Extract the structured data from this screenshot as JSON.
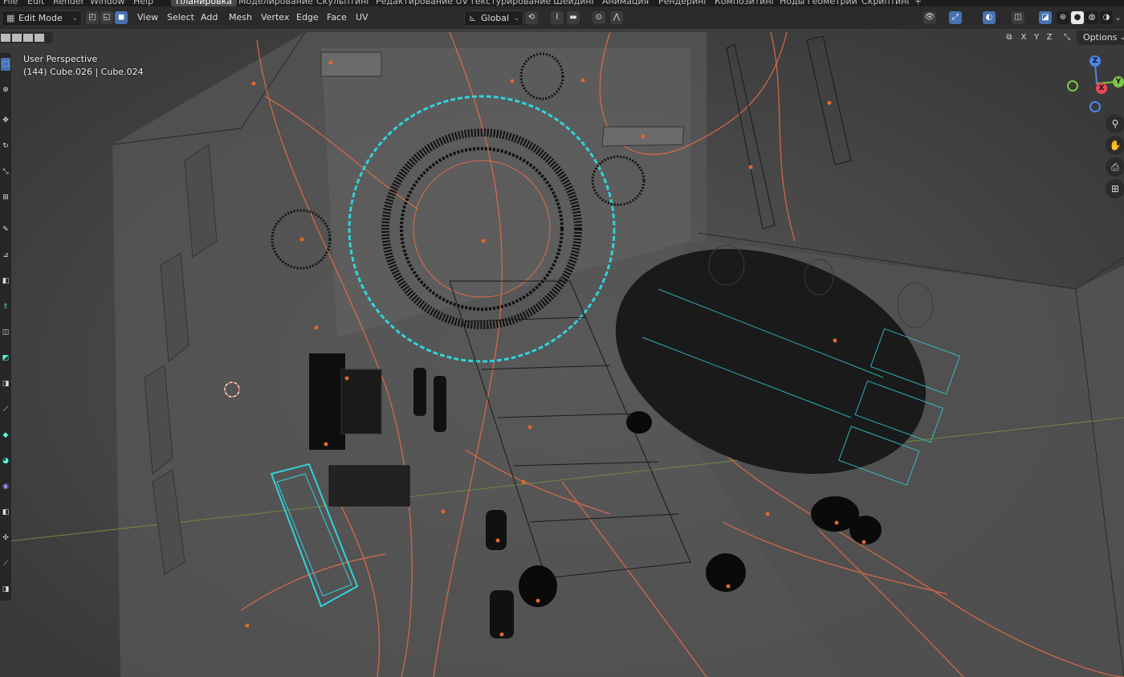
{
  "top_menu": {
    "file": "File",
    "edit": "Edit",
    "render": "Render",
    "window": "Window",
    "help": "Help",
    "workspaces": [
      "Планировка",
      "Моделирование",
      "Скульптинг",
      "Редактирование UV",
      "Текстурирование",
      "Шейдинг",
      "Анимация",
      "Рендеринг",
      "Композитинг",
      "Ноды геометрии",
      "Скриптинг"
    ],
    "active_workspace": "Планировка",
    "add_tab": "+"
  },
  "header": {
    "mode": "Edit Mode",
    "menus": [
      "View",
      "Select",
      "Add",
      "Mesh",
      "Vertex",
      "Edge",
      "Face",
      "UV"
    ],
    "transform_orientation": "Global"
  },
  "viewport": {
    "perspective": "User Perspective",
    "object_info": "(144) Cube.026 | Cube.024",
    "mirror_axes": [
      "X",
      "Y",
      "Z"
    ],
    "options": "Options"
  },
  "gizmo": {
    "z": "Z",
    "y": "Y",
    "x": "X"
  },
  "colors": {
    "viewport_bg": "#3d3d3d",
    "wire_orange": "#e06a4a",
    "selected_cyan": "#2fd3dc",
    "accent_blue": "#4772b3"
  }
}
